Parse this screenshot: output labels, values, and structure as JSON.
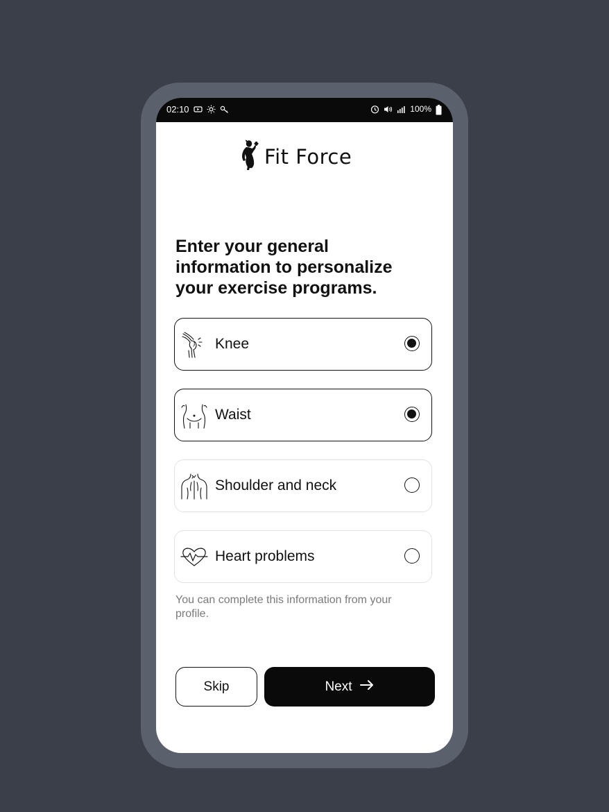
{
  "status_bar": {
    "time": "02:10",
    "battery": "100%",
    "left_icons": [
      "youtube-icon",
      "brightness-icon",
      "key-icon"
    ],
    "right_icons": [
      "alarm-icon",
      "volume-icon",
      "signal-icon",
      "battery-icon"
    ]
  },
  "brand": {
    "name": "Fit Force",
    "logo_icon": "fitness-woman-icon"
  },
  "heading": "Enter your general information to personalize your exercise programs.",
  "options": [
    {
      "label": "Knee",
      "icon": "knee-icon",
      "selected": true
    },
    {
      "label": "Waist",
      "icon": "waist-icon",
      "selected": true
    },
    {
      "label": "Shoulder and neck",
      "icon": "shoulder-neck-icon",
      "selected": false
    },
    {
      "label": "Heart problems",
      "icon": "heart-pulse-icon",
      "selected": false
    }
  ],
  "helper_text": "You can complete this information from your profile.",
  "actions": {
    "skip_label": "Skip",
    "next_label": "Next",
    "next_icon": "arrow-right-icon"
  },
  "colors": {
    "background": "#3a3f4a",
    "device_frame": "#5a616c",
    "primary": "#0a0a0a",
    "helper_text": "#7a7a7a"
  }
}
